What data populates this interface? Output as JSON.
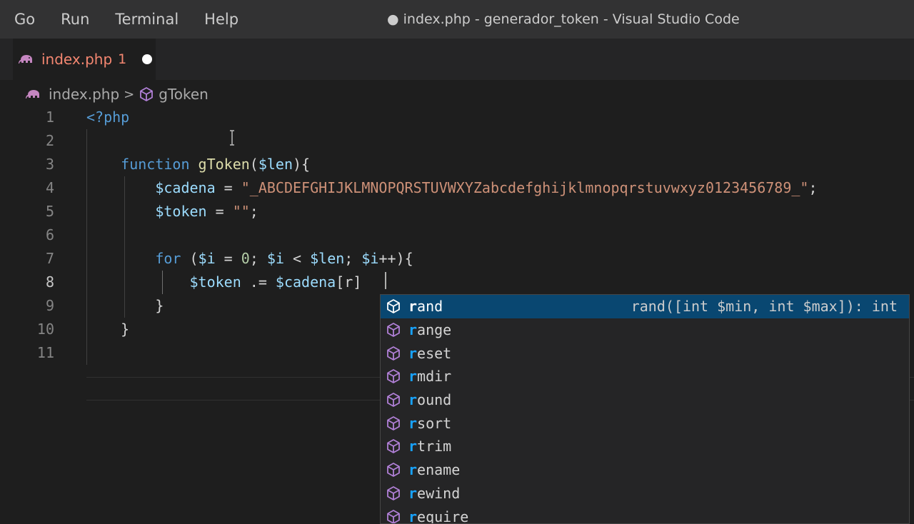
{
  "menu": {
    "items": [
      "Go",
      "Run",
      "Terminal",
      "Help"
    ]
  },
  "window": {
    "title": "● index.php - generador_token - Visual Studio Code"
  },
  "tab": {
    "label": "index.php",
    "badge": "1",
    "icon": "php-elephant-icon"
  },
  "breadcrumb": {
    "file": "index.php",
    "separator": ">",
    "symbol": "gToken"
  },
  "editor": {
    "active_line": 8,
    "lines": [
      {
        "n": "1",
        "tokens": [
          [
            "tag",
            "<?php"
          ]
        ]
      },
      {
        "n": "2",
        "tokens": []
      },
      {
        "n": "3",
        "tokens": [
          [
            "punc",
            "    "
          ],
          [
            "kw",
            "function "
          ],
          [
            "fn",
            "gToken"
          ],
          [
            "punc",
            "("
          ],
          [
            "var",
            "$len"
          ],
          [
            "punc",
            "){"
          ]
        ]
      },
      {
        "n": "4",
        "tokens": [
          [
            "punc",
            "        "
          ],
          [
            "var",
            "$cadena"
          ],
          [
            "punc",
            " = "
          ],
          [
            "str",
            "\"_ABCDEFGHIJKLMNOPQRSTUVWXYZabcdefghijklmnopqrstuvwxyz0123456789_\""
          ],
          [
            "punc",
            ";"
          ]
        ]
      },
      {
        "n": "5",
        "tokens": [
          [
            "punc",
            "        "
          ],
          [
            "var",
            "$token"
          ],
          [
            "punc",
            " = "
          ],
          [
            "str",
            "\"\""
          ],
          [
            "punc",
            ";"
          ]
        ]
      },
      {
        "n": "6",
        "tokens": []
      },
      {
        "n": "7",
        "tokens": [
          [
            "punc",
            "        "
          ],
          [
            "kw",
            "for "
          ],
          [
            "punc",
            "("
          ],
          [
            "var",
            "$i"
          ],
          [
            "punc",
            " = "
          ],
          [
            "num",
            "0"
          ],
          [
            "punc",
            "; "
          ],
          [
            "var",
            "$i"
          ],
          [
            "punc",
            " < "
          ],
          [
            "var",
            "$len"
          ],
          [
            "punc",
            "; "
          ],
          [
            "var",
            "$i"
          ],
          [
            "punc",
            "++){"
          ]
        ]
      },
      {
        "n": "8",
        "tokens": [
          [
            "punc",
            "            "
          ],
          [
            "var",
            "$token"
          ],
          [
            "punc",
            " .= "
          ],
          [
            "var",
            "$cadena"
          ],
          [
            "punc",
            "["
          ],
          [
            "punc",
            "r"
          ],
          [
            "punc",
            "]"
          ]
        ]
      },
      {
        "n": "9",
        "tokens": [
          [
            "punc",
            "        "
          ],
          [
            "punc",
            "}"
          ]
        ]
      },
      {
        "n": "10",
        "tokens": [
          [
            "punc",
            "    "
          ],
          [
            "punc",
            "}"
          ]
        ]
      },
      {
        "n": "11",
        "tokens": []
      }
    ]
  },
  "suggest": {
    "selected_detail": "rand([int $min, int $max]): int",
    "items": [
      {
        "first": "r",
        "rest": "and"
      },
      {
        "first": "r",
        "rest": "ange"
      },
      {
        "first": "r",
        "rest": "eset"
      },
      {
        "first": "r",
        "rest": "mdir"
      },
      {
        "first": "r",
        "rest": "ound"
      },
      {
        "first": "r",
        "rest": "sort"
      },
      {
        "first": "r",
        "rest": "trim"
      },
      {
        "first": "r",
        "rest": "ename"
      },
      {
        "first": "r",
        "rest": "ewind"
      },
      {
        "first": "r",
        "rest": "equire"
      }
    ]
  },
  "colors": {
    "keyword": "#569cd6",
    "function": "#dcdcaa",
    "variable": "#9cdcfe",
    "string": "#ce9178",
    "number": "#b5cea8",
    "selection": "#094771",
    "method_icon": "#b180d7"
  }
}
